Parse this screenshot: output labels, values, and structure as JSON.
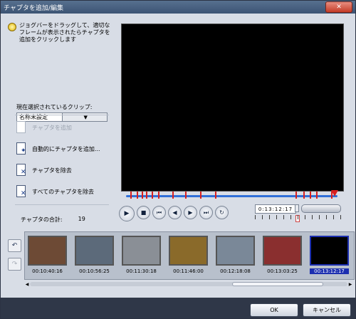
{
  "window": {
    "title": "チャプタを追加/編集",
    "close_glyph": "✕"
  },
  "hint": "ジョグバーをドラッグして、適切なフレームが表示されたらチャプタを追加をクリックします",
  "clip": {
    "label": "現在選択されているクリップ:",
    "value": "名称未設定"
  },
  "actions": {
    "add": "チャプタを追加",
    "auto_add": "自動的にチャプタを追加...",
    "remove": "チャプタを除去",
    "remove_all": "すべてのチャプタを除去"
  },
  "chapter_count": {
    "label": "チャプタの合計:",
    "value": "19"
  },
  "player": {
    "timecode": "0:13:12:17",
    "glyphs": {
      "play": "▶",
      "stop": "■",
      "first": "⏮",
      "prev": "◀",
      "next": "▶",
      "last": "⏭",
      "loop": "↻"
    }
  },
  "timeline": {
    "chapter_marks": [
      0.02,
      0.05,
      0.075,
      0.095,
      0.12,
      0.15,
      0.22,
      0.28,
      0.35,
      0.42,
      0.8,
      0.84,
      0.87,
      0.9,
      0.97
    ],
    "position": 0.985
  },
  "clips": [
    {
      "timecode": "00:10:40:16",
      "color": "#6d4a35"
    },
    {
      "timecode": "00:10:56:25",
      "color": "#5c6a7a"
    },
    {
      "timecode": "00:11:30:18",
      "color": "#8a8f96"
    },
    {
      "timecode": "00:11:46:00",
      "color": "#8a6a2a"
    },
    {
      "timecode": "00:12:18:08",
      "color": "#7a8898"
    },
    {
      "timecode": "00:13:03:25",
      "color": "#8a2f2f"
    },
    {
      "timecode": "00:13:12:17",
      "color": "#000000"
    }
  ],
  "buttons": {
    "ok": "OK",
    "cancel": "キャンセル"
  }
}
